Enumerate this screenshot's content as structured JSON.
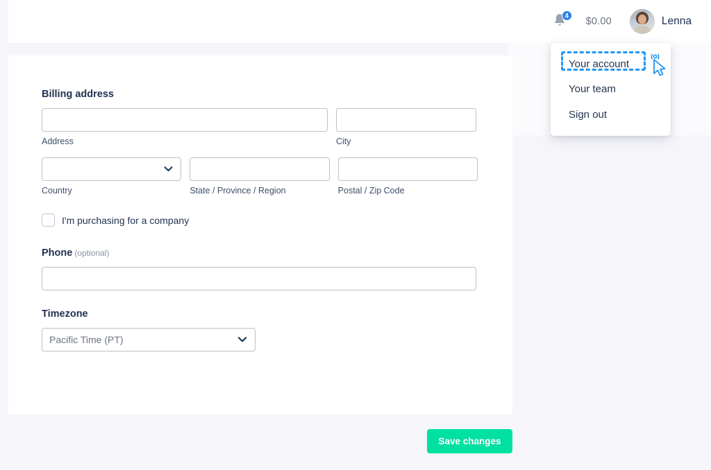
{
  "header": {
    "notifications": {
      "icon": "bell-icon",
      "count": "4",
      "badge_color": "#2f80ed"
    },
    "balance": "$0.00",
    "user": {
      "name": "Lenna",
      "avatar": "user-avatar"
    }
  },
  "account_menu": {
    "items": [
      {
        "label": "Your account",
        "highlighted": true
      },
      {
        "label": "Your team",
        "highlighted": false
      },
      {
        "label": "Sign out",
        "highlighted": false
      }
    ],
    "highlight_color": "#2196f3"
  },
  "cursor": {
    "icon": "click-cursor-icon",
    "color": "#2196f3"
  },
  "form": {
    "billing": {
      "title": "Billing address",
      "address": {
        "label": "Address",
        "value": "",
        "placeholder": ""
      },
      "city": {
        "label": "City",
        "value": "",
        "placeholder": ""
      },
      "country": {
        "label": "Country",
        "value": "",
        "options": [
          ""
        ]
      },
      "state": {
        "label": "State / Province / Region",
        "value": "",
        "placeholder": ""
      },
      "postal": {
        "label": "Postal / Zip Code",
        "value": "",
        "placeholder": ""
      }
    },
    "company": {
      "label": "I'm purchasing for a company",
      "checked": false
    },
    "phone": {
      "title": "Phone",
      "optional_note": "(optional)",
      "value": "",
      "placeholder": ""
    },
    "timezone": {
      "title": "Timezone",
      "value": "Pacific Time (PT)",
      "options": [
        "Pacific Time (PT)"
      ]
    },
    "save_label": "Save changes",
    "save_color": "#00e0a1"
  }
}
